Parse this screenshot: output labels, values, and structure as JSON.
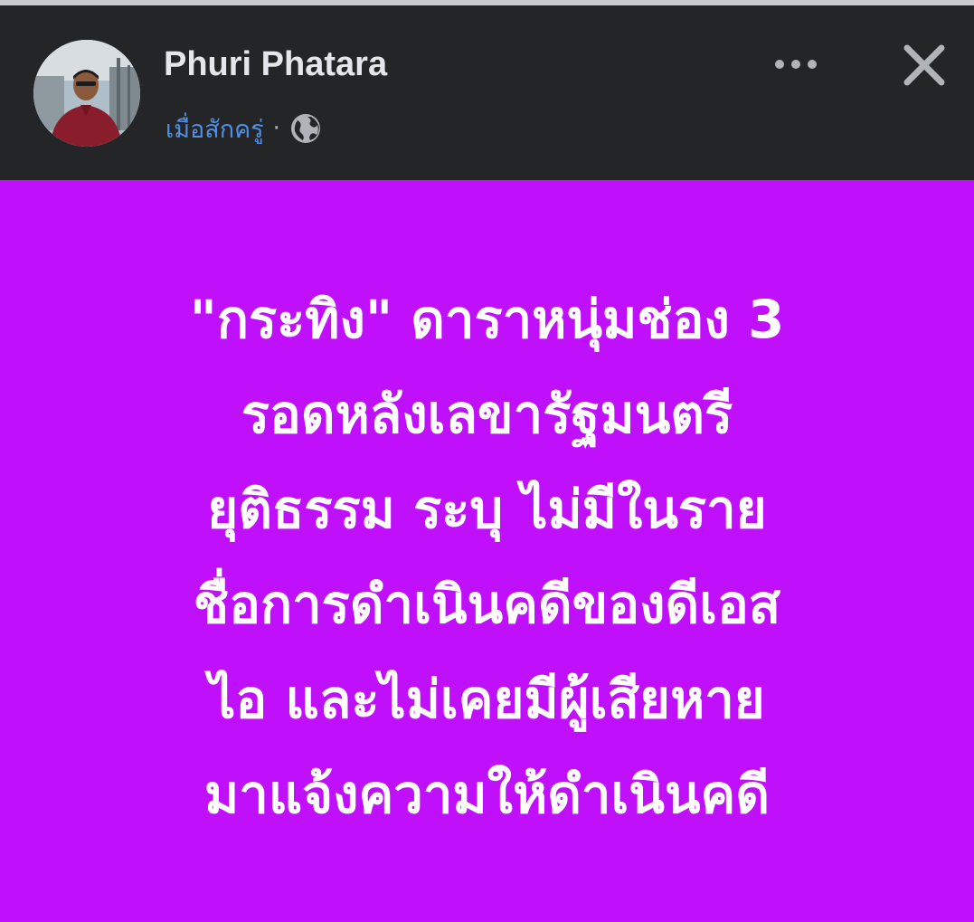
{
  "post": {
    "author_name": "Phuri Phatara",
    "timestamp": "เมื่อสักครู่",
    "separator": "·",
    "privacy_icon": "globe-icon",
    "more_icon": "more-horizontal-icon",
    "close_icon": "close-icon",
    "background_color": "#c00ffa",
    "text_lines": [
      "\"กระทิง\" ดาราหนุ่มช่อง 3",
      "รอดหลังเลขารัฐมนตรี",
      "ยุติธรรม ระบุ ไม่มีในราย",
      "ชื่อการดำเนินคดีของดีเอส",
      "ไอ และไม่เคยมีผู้เสียหาย",
      "มาแจ้งความให้ดำเนินคดี"
    ]
  }
}
